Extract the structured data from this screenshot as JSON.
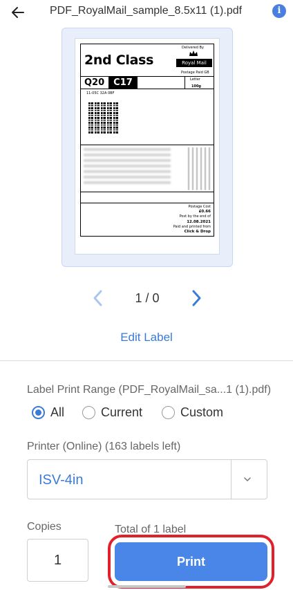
{
  "header": {
    "title": "PDF_RoyalMail_sample_8.5x11 (1).pdf",
    "back_icon": "arrow-left-icon",
    "info_icon": "info-icon",
    "info_glyph": "i"
  },
  "label_preview": {
    "service": "2nd Class",
    "delivered_by": "Delivered By",
    "carrier": "Royal Mail",
    "postage_paid": "Postage Paid GB",
    "zone": "Q20",
    "code": "C17",
    "format": "Letter",
    "weight": "100g",
    "reference": "11-05C 32A 0BF",
    "postage_cost_label": "Postage Cost",
    "postage_cost": "£0.66",
    "post_by_label": "Post by the end of",
    "post_by_date": "12.08.2021",
    "paid_printed": "Paid and printed from",
    "paid_printed_via": "Click & Drop"
  },
  "pager": {
    "text": "1 / 0"
  },
  "edit_label": "Edit Label",
  "range": {
    "title": "Label Print Range (PDF_RoyalMail_sa...1 (1).pdf)",
    "options": [
      "All",
      "Current",
      "Custom"
    ],
    "selected": "All"
  },
  "printer": {
    "title": "Printer (Online) (163 labels left)",
    "value": "ISV-4in"
  },
  "copies": {
    "title": "Copies",
    "value": "1"
  },
  "total": "Total of 1 label",
  "print_button": "Print",
  "colors": {
    "accent": "#3a7bd5",
    "button": "#4a86e8",
    "highlight": "#e0202a"
  }
}
